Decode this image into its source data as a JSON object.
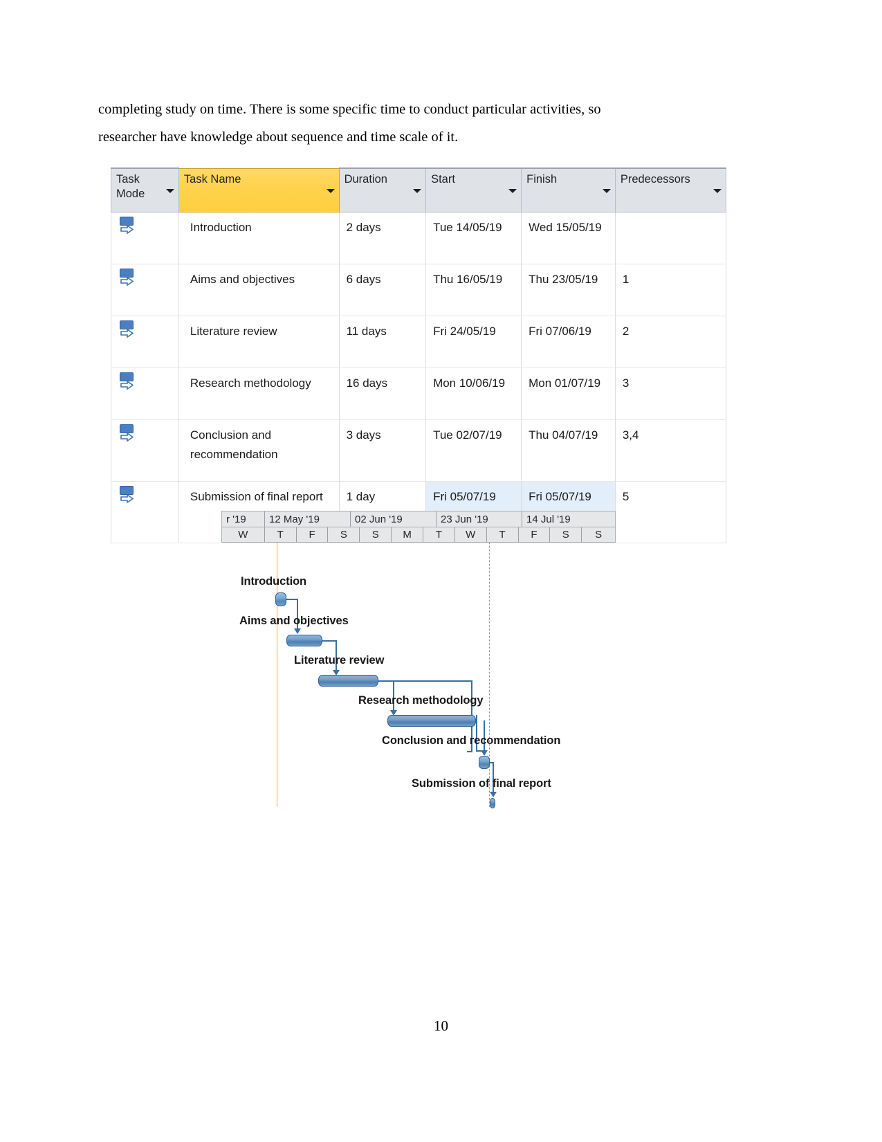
{
  "page": {
    "number": "10",
    "paragraph_line1": "completing study on time. There is some specific time to conduct particular activities, so",
    "paragraph_line2": "researcher have knowledge about sequence and time scale of it."
  },
  "table": {
    "columns": [
      {
        "label": "Task Mode",
        "highlighted": false
      },
      {
        "label": "Task Name",
        "highlighted": true
      },
      {
        "label": "Duration",
        "highlighted": false
      },
      {
        "label": "Start",
        "highlighted": false
      },
      {
        "label": "Finish",
        "highlighted": false
      },
      {
        "label": "Predecessors",
        "highlighted": false
      }
    ],
    "rows": [
      {
        "mode_icon": "manually-scheduled-icon",
        "name": "Introduction",
        "duration": "2 days",
        "start": "Tue 14/05/19",
        "finish": "Wed 15/05/19",
        "predecessors": ""
      },
      {
        "mode_icon": "manually-scheduled-icon",
        "name": "Aims and objectives",
        "duration": "6 days",
        "start": "Thu 16/05/19",
        "finish": "Thu 23/05/19",
        "predecessors": "1"
      },
      {
        "mode_icon": "manually-scheduled-icon",
        "name": "Literature review",
        "duration": "11 days",
        "start": "Fri 24/05/19",
        "finish": "Fri 07/06/19",
        "predecessors": "2"
      },
      {
        "mode_icon": "manually-scheduled-icon",
        "name": "Research methodology",
        "duration": "16 days",
        "start": "Mon 10/06/19",
        "finish": "Mon 01/07/19",
        "predecessors": "3"
      },
      {
        "mode_icon": "manually-scheduled-icon",
        "name": "Conclusion and recommendation",
        "duration": "3 days",
        "start": "Tue 02/07/19",
        "finish": "Thu 04/07/19",
        "predecessors": "3,4"
      },
      {
        "mode_icon": "manually-scheduled-icon",
        "name": "Submission of final report",
        "duration": "1 day",
        "start": "Fri 05/07/19",
        "finish": "Fri 05/07/19",
        "predecessors": "5"
      }
    ],
    "selected_cells": {
      "row_index": 5,
      "columns": [
        "start",
        "finish"
      ]
    }
  },
  "chart_data": {
    "type": "bar",
    "chart_kind": "gantt",
    "title": "",
    "xlabel": "",
    "ylabel": "",
    "timeline_weeks": [
      "r '19",
      "12 May '19",
      "02 Jun '19",
      "23 Jun '19",
      "14 Jul '19"
    ],
    "timeline_days": [
      "W",
      "T",
      "F",
      "S",
      "S",
      "M",
      "T",
      "W",
      "T",
      "F",
      "S",
      "S"
    ],
    "today_marker_label": "today-line",
    "categories": [
      "Introduction",
      "Aims and objectives",
      "Literature review",
      "Research methodology",
      "Conclusion and recommendation",
      "Submission of final report"
    ],
    "tasks": [
      {
        "name": "Introduction",
        "start": "Tue 14/05/19",
        "finish": "Wed 15/05/19",
        "duration_days": 2,
        "bar_type": "task"
      },
      {
        "name": "Aims and objectives",
        "start": "Thu 16/05/19",
        "finish": "Thu 23/05/19",
        "duration_days": 6,
        "bar_type": "task"
      },
      {
        "name": "Literature review",
        "start": "Fri 24/05/19",
        "finish": "Fri 07/06/19",
        "duration_days": 11,
        "bar_type": "task"
      },
      {
        "name": "Research methodology",
        "start": "Mon 10/06/19",
        "finish": "Mon 01/07/19",
        "duration_days": 16,
        "bar_type": "task"
      },
      {
        "name": "Conclusion and recommendation",
        "start": "Tue 02/07/19",
        "finish": "Thu 04/07/19",
        "duration_days": 3,
        "bar_type": "task"
      },
      {
        "name": "Submission of final report",
        "start": "Fri 05/07/19",
        "finish": "Fri 05/07/19",
        "duration_days": 1,
        "bar_type": "task"
      }
    ],
    "links": [
      {
        "from": "Introduction",
        "to": "Aims and objectives",
        "type": "finish-to-start"
      },
      {
        "from": "Aims and objectives",
        "to": "Literature review",
        "type": "finish-to-start"
      },
      {
        "from": "Literature review",
        "to": "Research methodology",
        "type": "finish-to-start"
      },
      {
        "from": "Literature review",
        "to": "Conclusion and recommendation",
        "type": "finish-to-start"
      },
      {
        "from": "Research methodology",
        "to": "Conclusion and recommendation",
        "type": "finish-to-start"
      },
      {
        "from": "Conclusion and recommendation",
        "to": "Submission of final report",
        "type": "finish-to-start"
      }
    ],
    "colors": {
      "bar_fill": "#6f9dc9",
      "bar_border": "#2f5f93",
      "link_line": "#3a6ea5",
      "today_line": "#e8a34a",
      "header_background": "#e6e7e9",
      "task_name_header_highlight": "#ffd24d"
    }
  }
}
